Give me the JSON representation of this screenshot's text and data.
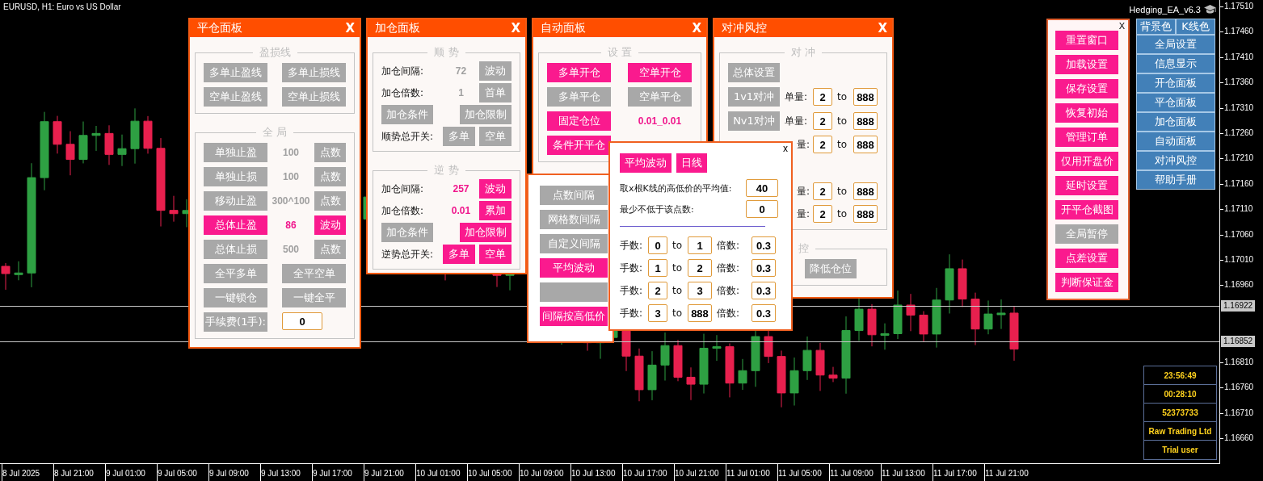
{
  "chart": {
    "symbol": "EURUSD, H1: Euro vs US Dollar",
    "ea_name": "Hedging_EA_v6.3",
    "price_upper": [
      "1.17510",
      "1.17460",
      "1.17410",
      "1.17360",
      "1.17310",
      "1.17260",
      "1.17210",
      "1.17160",
      "1.17110",
      "1.17060",
      "1.17010",
      "1.16960"
    ],
    "price_tags": [
      "1.16922",
      "1.16852"
    ],
    "price_lower": [
      "1.16810",
      "1.16760",
      "1.16710",
      "1.16660"
    ],
    "time_labels": [
      "8 Jul 2025",
      "8 Jul 21:00",
      "9 Jul 01:00",
      "9 Jul 05:00",
      "9 Jul 09:00",
      "9 Jul 13:00",
      "9 Jul 17:00",
      "9 Jul 21:00",
      "10 Jul 01:00",
      "10 Jul 05:00",
      "10 Jul 09:00",
      "10 Jul 13:00",
      "10 Jul 17:00",
      "10 Jul 21:00",
      "11 Jul 01:00",
      "11 Jul 05:00",
      "11 Jul 09:00",
      "11 Jul 13:00",
      "11 Jul 17:00",
      "11 Jul 21:00"
    ]
  },
  "close_panel": {
    "title": "平仓面板",
    "close": "X",
    "pl_group": {
      "title": "盈损线",
      "buttons": [
        {
          "label": "多单止盈线",
          "on": false
        },
        {
          "label": "多单止损线",
          "on": false
        },
        {
          "label": "空单止盈线",
          "on": false
        },
        {
          "label": "空单止损线",
          "on": false
        }
      ]
    },
    "global_group": {
      "title": "全 局",
      "rows": [
        {
          "button": {
            "label": "单独止盈",
            "on": false
          },
          "value": {
            "text": "100",
            "on": false
          },
          "unit": {
            "label": "点数",
            "on": false
          }
        },
        {
          "button": {
            "label": "单独止损",
            "on": false
          },
          "value": {
            "text": "100",
            "on": false
          },
          "unit": {
            "label": "点数",
            "on": false
          }
        },
        {
          "button": {
            "label": "移动止盈",
            "on": false
          },
          "value": {
            "text": "300^100",
            "on": false
          },
          "unit": {
            "label": "点数",
            "on": false
          }
        },
        {
          "button": {
            "label": "总体止盈",
            "on": true
          },
          "value": {
            "text": "86",
            "on": true
          },
          "unit": {
            "label": "波动",
            "on": true
          }
        },
        {
          "button": {
            "label": "总体止损",
            "on": false
          },
          "value": {
            "text": "500",
            "on": false
          },
          "unit": {
            "label": "点数",
            "on": false
          }
        }
      ],
      "pairs": [
        {
          "label": "全平多单",
          "on": false
        },
        {
          "label": "全平空单",
          "on": false
        },
        {
          "label": "一键锁仓",
          "on": false
        },
        {
          "label": "一键全平",
          "on": false
        }
      ],
      "fee": {
        "label": "手续费(1手):",
        "value": "0"
      }
    }
  },
  "add_panel": {
    "title": "加仓面板",
    "close": "X",
    "groups": [
      {
        "title": "顺 势",
        "rows": [
          {
            "label": "加仓间隔:",
            "value": {
              "text": "72",
              "on": false
            },
            "button": {
              "label": "波动",
              "on": false
            }
          },
          {
            "label": "加仓倍数:",
            "value": {
              "text": "1",
              "on": false
            },
            "button": {
              "label": "首单",
              "on": false
            }
          }
        ],
        "conditions": [
          {
            "label": "加仓条件",
            "on": false
          },
          {
            "label": "加仓限制",
            "on": false
          }
        ],
        "switch": {
          "label": "顺势总开关:",
          "buttons": [
            {
              "label": "多单",
              "on": false
            },
            {
              "label": "空单",
              "on": false
            }
          ]
        }
      },
      {
        "title": "逆 势",
        "rows": [
          {
            "label": "加仓间隔:",
            "value": {
              "text": "257",
              "on": true
            },
            "button": {
              "label": "波动",
              "on": true
            }
          },
          {
            "label": "加仓倍数:",
            "value": {
              "text": "0.01",
              "on": true
            },
            "button": {
              "label": "累加",
              "on": true
            }
          }
        ],
        "conditions": [
          {
            "label": "加仓条件",
            "on": false
          },
          {
            "label": "加仓限制",
            "on": true
          }
        ],
        "switch": {
          "label": "逆势总开关:",
          "buttons": [
            {
              "label": "多单",
              "on": true
            },
            {
              "label": "空单",
              "on": true
            }
          ]
        }
      }
    ]
  },
  "auto_panel": {
    "title": "自动面板",
    "close": "X",
    "group_title": "设 置",
    "rows": [
      [
        {
          "kind": "button",
          "label": "多单开仓",
          "on": true
        },
        {
          "kind": "button",
          "label": "空单开仓",
          "on": true
        }
      ],
      [
        {
          "kind": "button",
          "label": "多单平仓",
          "on": false
        },
        {
          "kind": "button",
          "label": "空单平仓",
          "on": false
        }
      ],
      [
        {
          "kind": "button",
          "label": "固定仓位",
          "on": true
        },
        {
          "kind": "value",
          "label": "0.01_0.01",
          "on": true
        }
      ],
      [
        {
          "kind": "button",
          "label": "条件开平仓",
          "on": true
        }
      ]
    ]
  },
  "hedge_panel": {
    "title": "对冲风控",
    "close": "X",
    "hedge_group": {
      "title": "对 冲",
      "overall": {
        "label": "总体设置",
        "on": false
      },
      "rows": [
        {
          "button": {
            "label": "1v1对冲",
            "on": false
          },
          "qty_label": "单量:",
          "from": "2",
          "to_label": "to",
          "to": "888"
        },
        {
          "button": {
            "label": "Nv1对冲",
            "on": false
          },
          "qty_label": "单量:",
          "from": "2",
          "to_label": "to",
          "to": "888"
        },
        {
          "qty_label": "量:",
          "from": "2",
          "to_label": "to",
          "to": "888"
        },
        {
          "qty_label": "量:",
          "from": "2",
          "to_label": "to",
          "to": "888"
        },
        {
          "qty_label": "量:",
          "from": "2",
          "to_label": "to",
          "to": "888"
        }
      ]
    },
    "risk_group": {
      "title": "控",
      "buttons": [
        {
          "label": "降低仓位",
          "on": false
        }
      ]
    }
  },
  "interval_popup": {
    "buttons": [
      {
        "label": "点数间隔",
        "on": false
      },
      {
        "label": "网格数间隔",
        "on": false
      },
      {
        "label": "自定义间隔",
        "on": false
      },
      {
        "label": "平均波动",
        "on": true
      },
      {
        "on": false
      },
      {
        "label": "间隔按高低价",
        "on": true
      }
    ]
  },
  "avg_popup": {
    "close": "x",
    "tabs": [
      {
        "label": "平均波动",
        "on": true
      },
      {
        "label": "日线",
        "on": true
      }
    ],
    "fields": [
      {
        "label": "取x根K线的高低价的平均值:",
        "value": "40"
      },
      {
        "label": "最少不低于该点数:",
        "value": "0"
      }
    ],
    "lot_rows": [
      {
        "lots_label": "手数:",
        "from": "0",
        "to_label": "to",
        "to": "1",
        "mult_label": "倍数:",
        "mult": "0.3"
      },
      {
        "lots_label": "手数:",
        "from": "1",
        "to_label": "to",
        "to": "2",
        "mult_label": "倍数:",
        "mult": "0.3"
      },
      {
        "lots_label": "手数:",
        "from": "2",
        "to_label": "to",
        "to": "3",
        "mult_label": "倍数:",
        "mult": "0.3"
      },
      {
        "lots_label": "手数:",
        "from": "3",
        "to_label": "to",
        "to": "888",
        "mult_label": "倍数:",
        "mult": "0.3"
      }
    ]
  },
  "right_menu": {
    "close": "X",
    "buttons": [
      {
        "label": "重置窗口",
        "on": true
      },
      {
        "label": "加载设置",
        "on": true
      },
      {
        "label": "保存设置",
        "on": true
      },
      {
        "label": "恢复初始",
        "on": true
      },
      {
        "label": "管理订单",
        "on": true
      },
      {
        "label": "仅用开盘价",
        "on": true
      },
      {
        "label": "延时设置",
        "on": true
      },
      {
        "label": "开平仓截图",
        "on": true
      },
      {
        "label": "全局暂停",
        "on": false
      },
      {
        "label": "点差设置",
        "on": true
      },
      {
        "label": "判断保证金",
        "on": true
      }
    ]
  },
  "blue_menu": {
    "top": [
      "背景色",
      "K线色"
    ],
    "items": [
      "全局设置",
      "信息显示",
      "开仓面板",
      "平仓面板",
      "加仓面板",
      "自动面板",
      "对冲风控",
      "帮助手册"
    ]
  },
  "info_box": [
    "23:56:49",
    "00:28:10",
    "52373733",
    "Raw Trading Ltd",
    "Trial user"
  ]
}
